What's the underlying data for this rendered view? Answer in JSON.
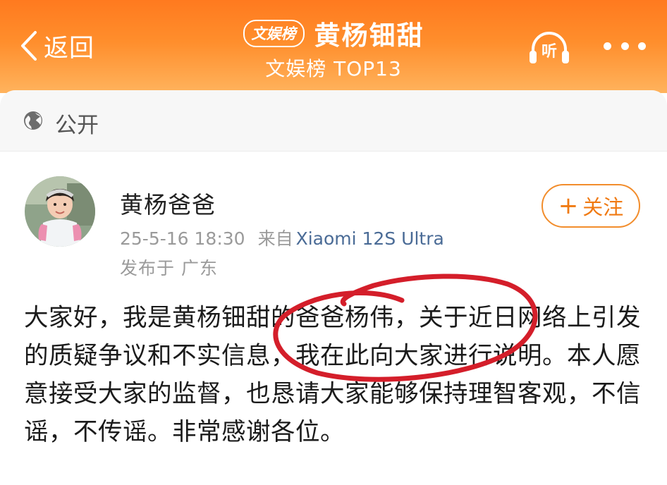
{
  "header": {
    "back_label": "返回",
    "rank_badge": "文娱榜",
    "title": "黄杨钿甜",
    "subtitle": "文娱榜 TOP13",
    "listen_label": "听"
  },
  "visibility": {
    "icon": "globe-icon",
    "label": "公开"
  },
  "post": {
    "author_name": "黄杨爸爸",
    "timestamp": "25-5-16 18:30",
    "from_label": "来自",
    "device": "Xiaomi 12S Ultra",
    "location": "发布于 广东",
    "follow_label": "关注",
    "body": "大家好，我是黄杨钿甜的爸爸杨伟，关于近日网络上引发的质疑争议和不实信息，我在此向大家进行说明。本人愿意接受大家的监督，也恳请大家能够保持理智客观，不信谣，不传谣。非常感谢各位。"
  },
  "colors": {
    "header_orange": "#ff7a1f",
    "follow_orange": "#f07a12",
    "device_link": "#4a6b96",
    "annotation_red": "#d41e2a"
  }
}
